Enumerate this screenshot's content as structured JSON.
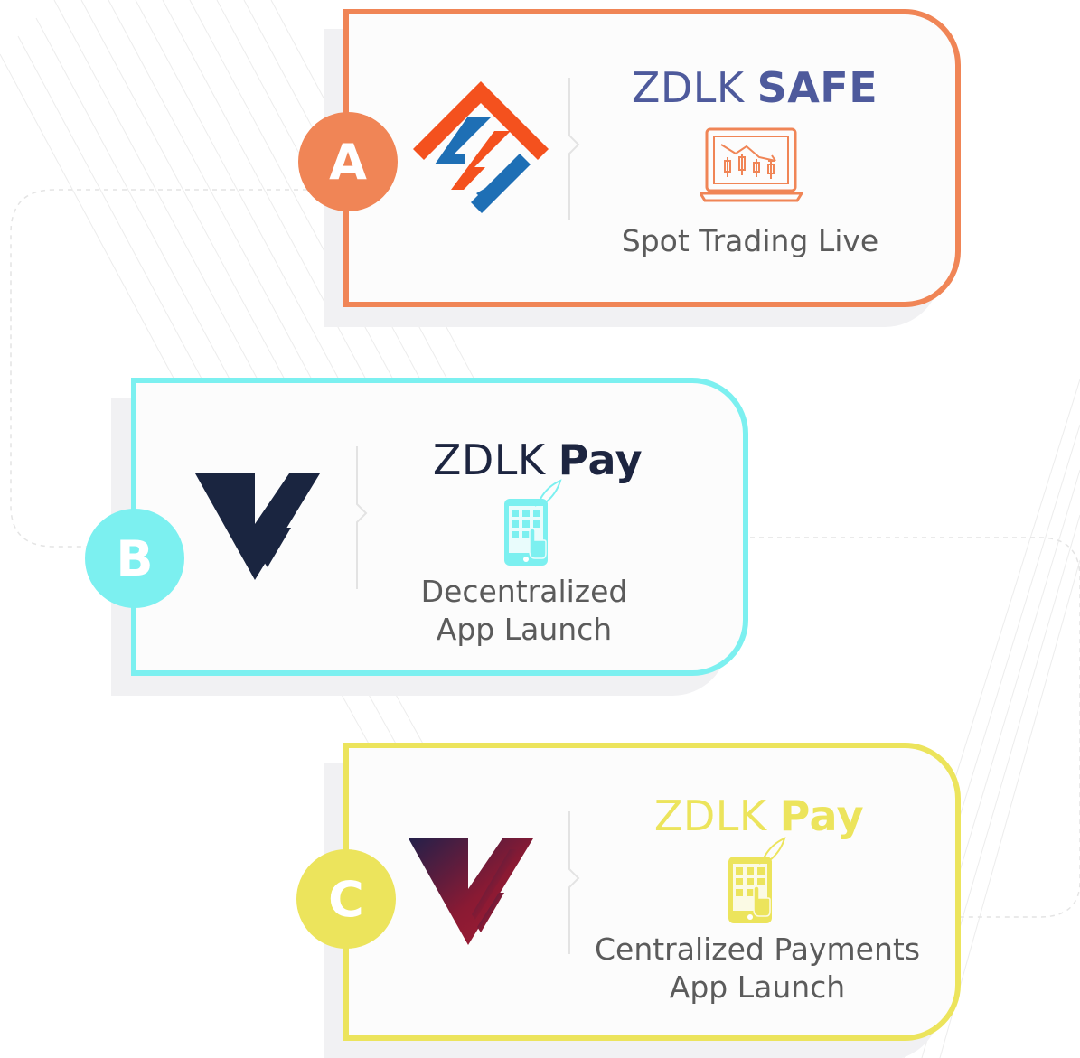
{
  "steps": [
    {
      "letter": "A",
      "brand": "ZDLK",
      "product": "SAFE",
      "caption_lines": [
        "Spot Trading Live"
      ],
      "color": "#f08556",
      "title_color": "#4e5a9c",
      "logo": "zdlk-safe-diamond-logo",
      "icon": "laptop-candlestick-chart-icon"
    },
    {
      "letter": "B",
      "brand": "ZDLK",
      "product": "Pay",
      "caption_lines": [
        "Decentralized",
        "App Launch"
      ],
      "color": "#7cf0f0",
      "title_color": "#1d2540",
      "logo": "navy-v-logo",
      "icon": "mobile-app-rocket-icon"
    },
    {
      "letter": "C",
      "brand": "ZDLK",
      "product": "Pay",
      "caption_lines": [
        "Centralized Payments",
        "App Launch"
      ],
      "color": "#ece45c",
      "title_color": "#ece45c",
      "logo": "gradient-v-logo",
      "icon": "mobile-app-rocket-icon"
    }
  ]
}
